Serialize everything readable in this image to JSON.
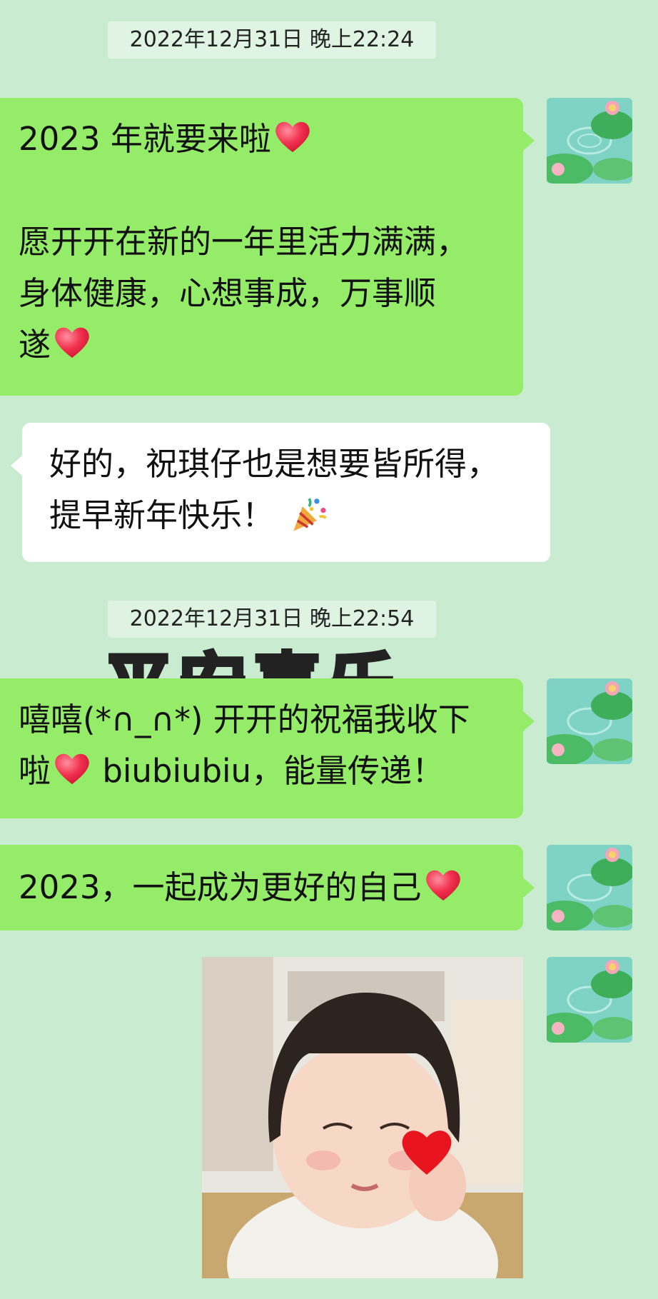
{
  "timestamps": [
    "2022年12月31日 晚上22:24",
    "2022年12月31日 晚上22:54"
  ],
  "messages": [
    {
      "lines": [
        "2023 年就要来啦",
        "",
        "愿开开在新的一年里活力满满，",
        "身体健康，心想事成，万事顺",
        "遂"
      ]
    },
    {
      "lines": [
        "好的，祝琪仔也是想要皆所得，",
        "提早新年快乐！"
      ]
    },
    {
      "lines": [
        "嘻嘻(*∩_∩*) 开开的祝福我收下",
        "啦",
        " biubiubiu，能量传递！"
      ]
    },
    {
      "lines": [
        "2023，一起成为更好的自己"
      ]
    }
  ],
  "sticker_text": "平安喜乐",
  "icons": {
    "heart": "red-heart-icon",
    "party": "party-popper-icon",
    "avatar": "lotus-pond-avatar"
  },
  "colors": {
    "background": "#c9ecd0",
    "outgoing_bubble": "#95ec69",
    "incoming_bubble": "#ffffff"
  }
}
